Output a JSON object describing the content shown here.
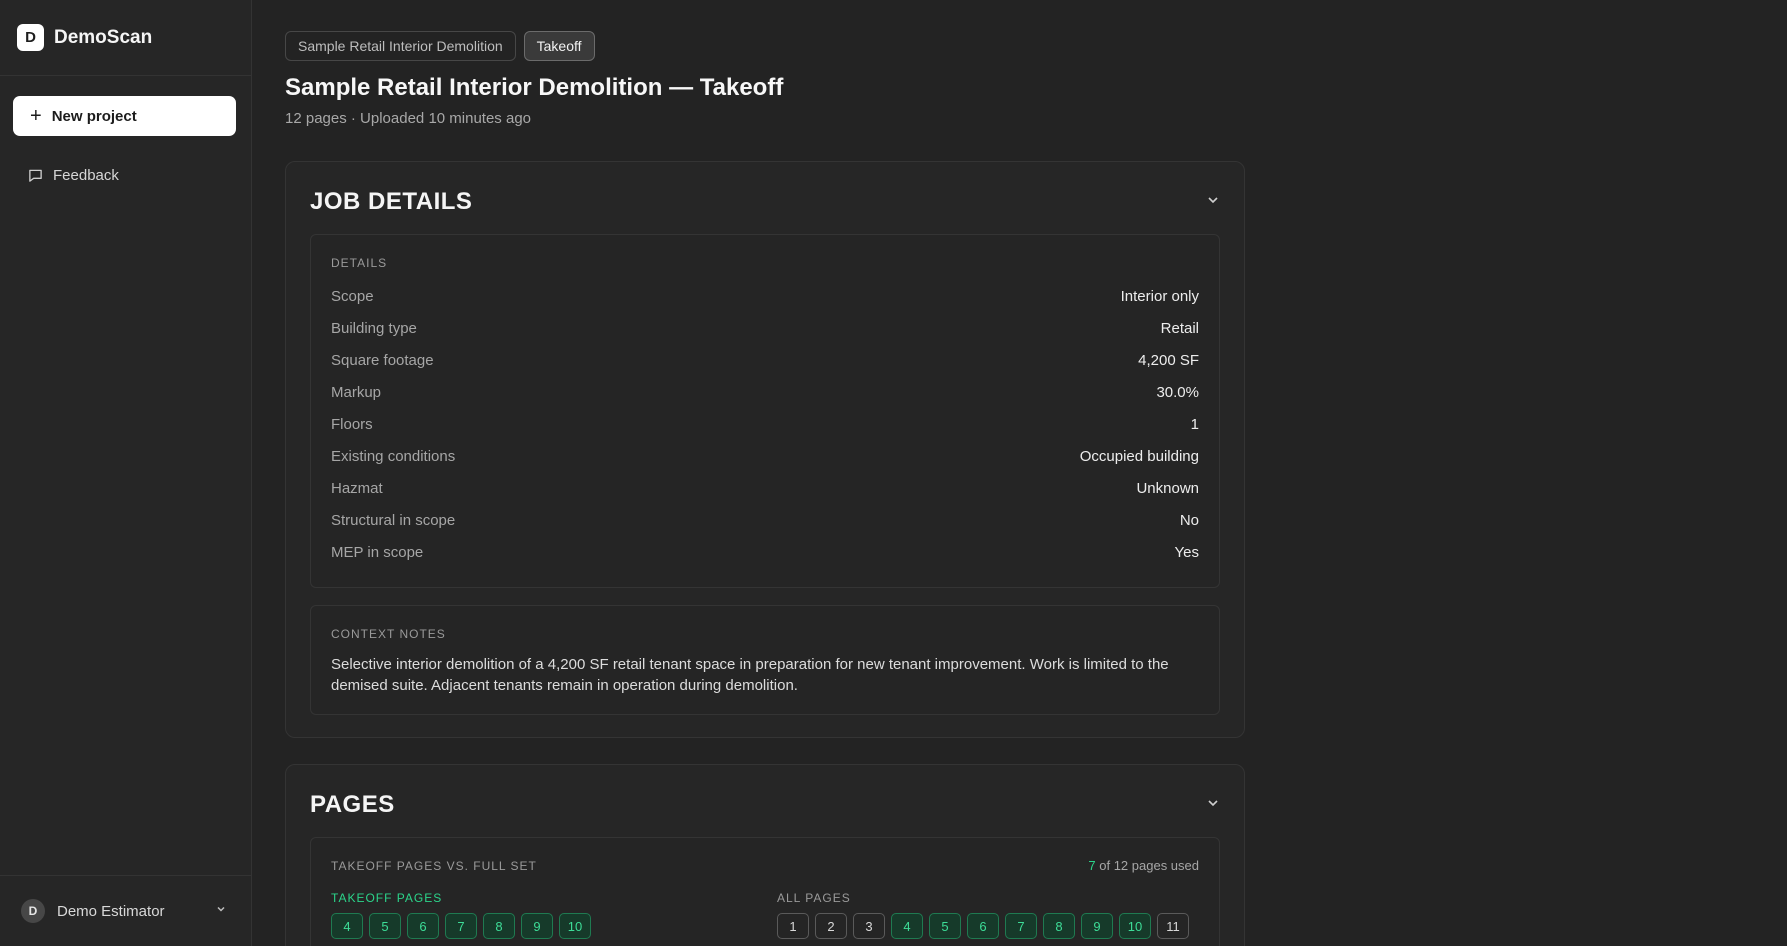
{
  "sidebar": {
    "brand_initial": "D",
    "brand_name": "DemoScan",
    "new_project_label": "New project",
    "feedback_label": "Feedback",
    "user_initial": "D",
    "user_name": "Demo Estimator"
  },
  "breadcrumbs": [
    "Sample Retail Interior Demolition",
    "Takeoff"
  ],
  "page": {
    "title": "Sample Retail Interior Demolition — Takeoff",
    "subtitle": "12 pages · Uploaded 10 minutes ago"
  },
  "job_details": {
    "heading": "JOB DETAILS",
    "details_label": "DETAILS",
    "rows": [
      {
        "key": "Scope",
        "value": "Interior only"
      },
      {
        "key": "Building type",
        "value": "Retail"
      },
      {
        "key": "Square footage",
        "value": "4,200 SF"
      },
      {
        "key": "Markup",
        "value": "30.0%"
      },
      {
        "key": "Floors",
        "value": "1"
      },
      {
        "key": "Existing conditions",
        "value": "Occupied building"
      },
      {
        "key": "Hazmat",
        "value": "Unknown"
      },
      {
        "key": "Structural in scope",
        "value": "No"
      },
      {
        "key": "MEP in scope",
        "value": "Yes"
      }
    ],
    "notes_label": "CONTEXT NOTES",
    "notes_text": "Selective interior demolition of a 4,200 SF retail tenant space in preparation for new tenant improvement. Work is limited to the demised suite. Adjacent tenants remain in operation during demolition."
  },
  "pages": {
    "heading": "PAGES",
    "compare_label": "TAKEOFF PAGES VS. FULL SET",
    "used_count": "7",
    "used_suffix": " of 12 pages used",
    "takeoff_label": "TAKEOFF PAGES",
    "takeoff_pages": [
      "4",
      "5",
      "6",
      "7",
      "8",
      "9",
      "10"
    ],
    "all_label": "ALL PAGES",
    "all_pages": [
      {
        "n": "1",
        "used": false
      },
      {
        "n": "2",
        "used": false
      },
      {
        "n": "3",
        "used": false
      },
      {
        "n": "4",
        "used": true
      },
      {
        "n": "5",
        "used": true
      },
      {
        "n": "6",
        "used": true
      },
      {
        "n": "7",
        "used": true
      },
      {
        "n": "8",
        "used": true
      },
      {
        "n": "9",
        "used": true
      },
      {
        "n": "10",
        "used": true
      },
      {
        "n": "11",
        "used": false
      }
    ]
  },
  "colors": {
    "accent_green": "#3ddc97",
    "background": "#232323"
  }
}
